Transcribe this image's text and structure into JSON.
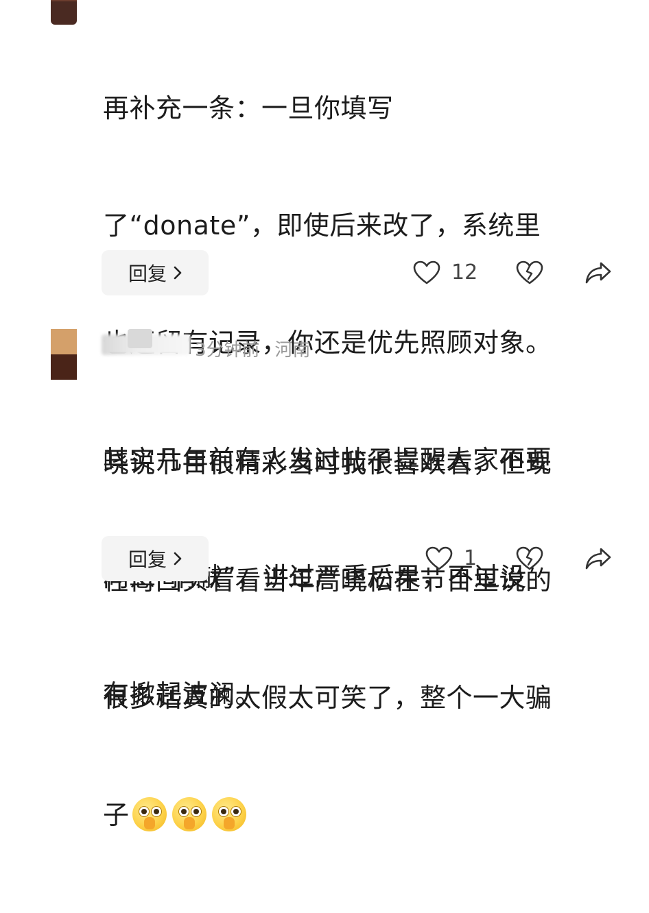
{
  "comments": [
    {
      "text_lines": [
        "再补充一条：一旦你填写",
        "了“donate”，即使后来改了，系统里",
        "也还留有记录，你还是优先照顾对象。",
        "其实几年前有人发过帖子提醒大家不要",
        "同意“捐献”，讲过严重后果，不过没",
        "有掀起波澜。"
      ],
      "reply_label": "回复",
      "reply_chevron": "›",
      "like_count": "12",
      "icons": {
        "like": "heart-icon",
        "dislike": "broken-heart-icon",
        "share": "share-arrow-icon"
      }
    },
    {
      "time": "3分钟前",
      "region": "河南",
      "text_lines": [
        "晓说节目很精彩当时我很喜欢看，但现",
        "在再回头看看当年高晓松在节目里说的",
        "很多话真的太假太可笑了，整个一大骗",
        "子"
      ],
      "emoji": "shocked-face-emoji",
      "emoji_count": 3,
      "reply_label": "回复",
      "reply_chevron": "›",
      "like_count": "1",
      "icons": {
        "like": "heart-icon",
        "dislike": "broken-heart-icon",
        "share": "share-arrow-icon"
      }
    }
  ]
}
